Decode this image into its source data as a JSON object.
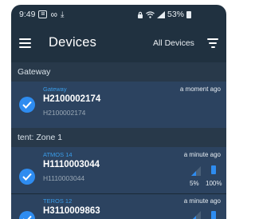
{
  "status_bar": {
    "time": "9:49",
    "battery_percent": "53%",
    "icons_left": [
      "notification-box-icon",
      "infinity-icon",
      "download-icon"
    ],
    "icons_right": [
      "lock-icon",
      "wifi-icon",
      "signal-icon",
      "battery-icon"
    ]
  },
  "toolbar": {
    "title": "Devices",
    "filter_label": "All Devices"
  },
  "sections": [
    {
      "header": "Gateway",
      "devices": [
        {
          "type": "Gateway",
          "name": "H2100002174",
          "serial": "H2100002174",
          "last_seen": "a moment ago",
          "selected": true
        }
      ]
    },
    {
      "header": "tent: Zone 1",
      "devices": [
        {
          "type": "ATMOS 14",
          "name": "H1110003044",
          "serial": "H1110003044",
          "last_seen": "a minute ago",
          "selected": true,
          "signal": "5%",
          "battery": "100%"
        },
        {
          "type": "TEROS 12",
          "name": "H3110009863",
          "last_seen": "a minute ago",
          "selected": true
        }
      ]
    }
  ],
  "colors": {
    "background": "#203140",
    "section_header": "#28394a",
    "row": "#2c4360",
    "accent": "#2e8cf0",
    "type_label": "#3a9ce8"
  }
}
